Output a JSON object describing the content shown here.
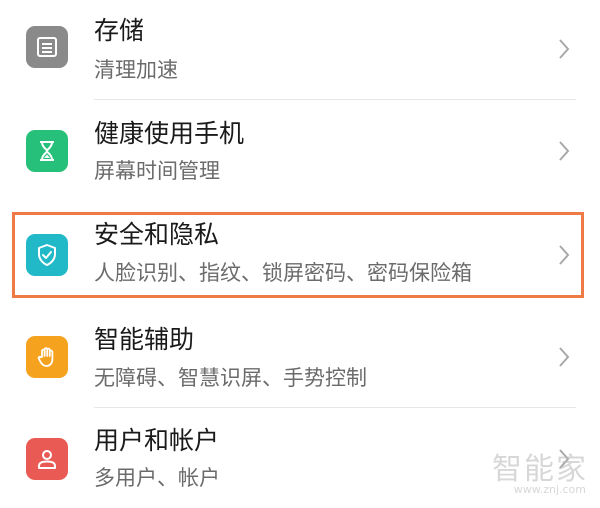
{
  "settings": {
    "items": [
      {
        "title": "存储",
        "subtitle": "清理加速",
        "icon": "storage-icon",
        "icon_color": "#8a8a8a"
      },
      {
        "title": "健康使用手机",
        "subtitle": "屏幕时间管理",
        "icon": "hourglass-icon",
        "icon_color": "#27c07a"
      },
      {
        "title": "安全和隐私",
        "subtitle": "人脸识别、指纹、锁屏密码、密码保险箱",
        "icon": "shield-check-icon",
        "icon_color": "#21b9c7",
        "highlighted": true
      },
      {
        "title": "智能辅助",
        "subtitle": "无障碍、智慧识屏、手势控制",
        "icon": "hand-icon",
        "icon_color": "#f5a21f"
      },
      {
        "title": "用户和帐户",
        "subtitle": "多用户、帐户",
        "icon": "user-icon",
        "icon_color": "#ea5a54"
      }
    ]
  },
  "highlight_color": "#ee7a45",
  "watermark": {
    "logo": "智能家",
    "url": "www.znj.com"
  }
}
